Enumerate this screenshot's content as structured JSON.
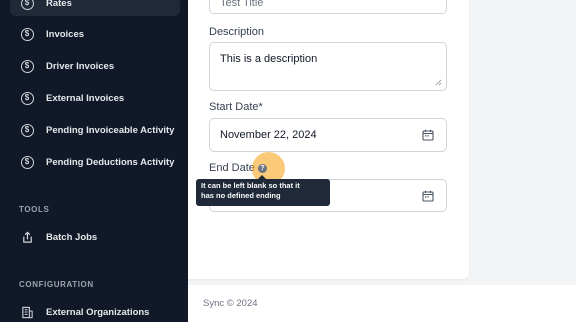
{
  "sidebar": {
    "items": [
      {
        "label": "Rates",
        "icon": "dollar-circle-icon"
      },
      {
        "label": "Invoices",
        "icon": "dollar-circle-icon"
      },
      {
        "label": "Driver Invoices",
        "icon": "dollar-circle-icon"
      },
      {
        "label": "External Invoices",
        "icon": "dollar-circle-icon"
      },
      {
        "label": "Pending Invoiceable Activity",
        "icon": "dollar-circle-icon"
      },
      {
        "label": "Pending Deductions Activity",
        "icon": "dollar-circle-icon"
      }
    ],
    "tools_title": "TOOLS",
    "tools": [
      {
        "label": "Batch Jobs",
        "icon": "upload-icon"
      }
    ],
    "config_title": "CONFIGURATION",
    "config": [
      {
        "label": "External Organizations",
        "icon": "building-icon"
      }
    ]
  },
  "form": {
    "title_value": "Test Title",
    "description_label": "Description",
    "description_value": "This is a description",
    "start_date_label": "Start Date*",
    "start_date_value": "November 22, 2024",
    "end_date_label": "End Date",
    "end_date_value": "",
    "help_glyph": "?",
    "tooltip_line1": "It can be left blank so that it",
    "tooltip_line2": "has no defined ending"
  },
  "footer": {
    "text": "Sync © 2024"
  },
  "colors": {
    "sidebar_bg": "#111827",
    "accent": "#f59e0b"
  }
}
